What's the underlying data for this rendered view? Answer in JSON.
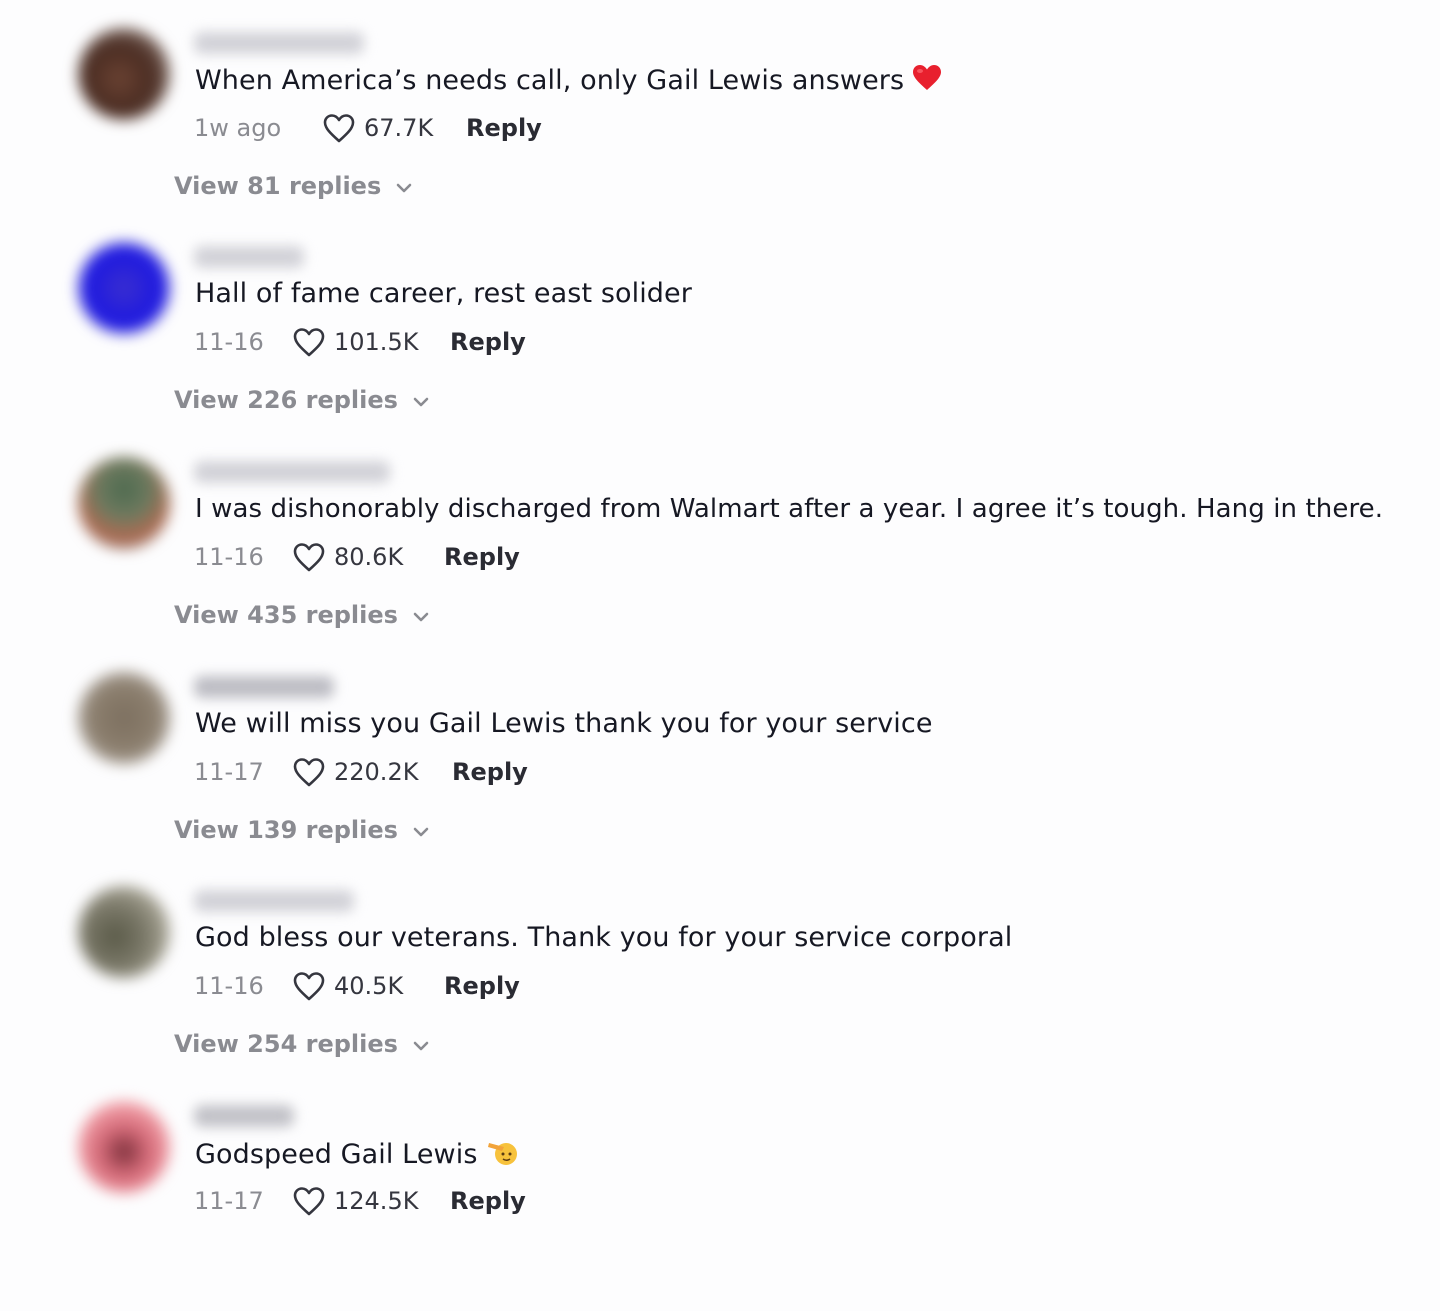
{
  "comments": [
    {
      "text": "When America’s needs call, only Gail Lewis answers",
      "emoji": "red-heart",
      "date": "1w ago",
      "likes": "67.7K",
      "reply_label": "Reply",
      "view_replies": "View 81 replies"
    },
    {
      "text": "Hall of fame career, rest east solider",
      "date": "11-16",
      "likes": "101.5K",
      "reply_label": "Reply",
      "view_replies": "View 226 replies"
    },
    {
      "text": "I was dishonorably discharged from Walmart after a year. I agree it’s tough. Hang in there.",
      "date": "11-16",
      "likes": "80.6K",
      "reply_label": "Reply",
      "view_replies": "View 435 replies"
    },
    {
      "text": "We will miss you Gail Lewis thank you for your service",
      "date": "11-17",
      "likes": "220.2K",
      "reply_label": "Reply",
      "view_replies": "View 139 replies"
    },
    {
      "text": "God bless our veterans. Thank you for your service corporal",
      "date": "11-16",
      "likes": "40.5K",
      "reply_label": "Reply",
      "view_replies": "View 254 replies"
    },
    {
      "text": "Godspeed Gail Lewis",
      "emoji": "saluting-face",
      "date": "11-17",
      "likes": "124.5K",
      "reply_label": "Reply"
    }
  ],
  "colors": {
    "text_primary": "#161823",
    "text_secondary": "#8a8b91",
    "heart_red": "#e8202e",
    "background": "#fdfdfe"
  }
}
